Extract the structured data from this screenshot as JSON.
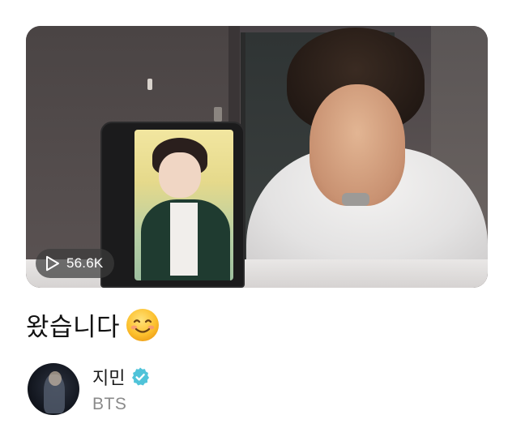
{
  "post": {
    "video": {
      "views": "56.6K",
      "play_icon": "play-outline-icon"
    },
    "caption": {
      "text": "왔습니다",
      "emoji_icon": "smiling-face-icon"
    },
    "author": {
      "name": "지민",
      "group": "BTS",
      "verified": true,
      "verified_icon": "verified-badge-icon"
    }
  },
  "colors": {
    "verified_badge": "#4fc3d9",
    "secondary_text": "#8a8a8a",
    "views_pill_bg": "#3c3c3c"
  }
}
